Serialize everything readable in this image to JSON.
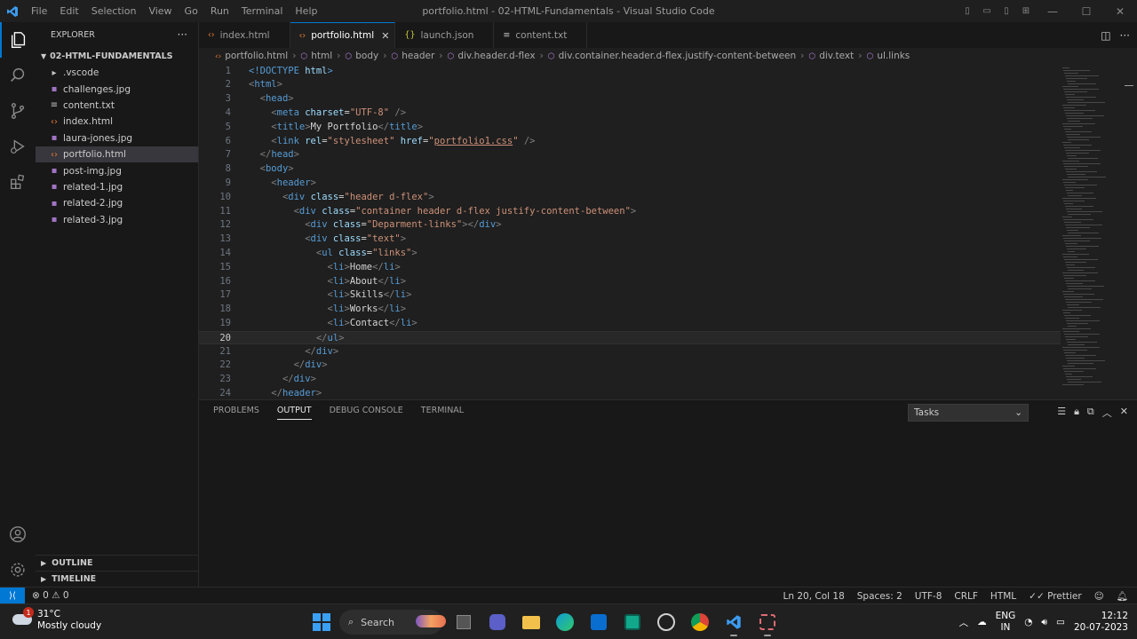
{
  "window": {
    "title": "portfolio.html - 02-HTML-Fundamentals - Visual Studio Code",
    "menu": [
      "File",
      "Edit",
      "Selection",
      "View",
      "Go",
      "Run",
      "Terminal",
      "Help"
    ]
  },
  "sidebar": {
    "header": "EXPLORER",
    "folder": "02-HTML-FUNDAMENTALS",
    "items": [
      {
        "label": ".vscode",
        "type": "folder"
      },
      {
        "label": "challenges.jpg",
        "type": "image"
      },
      {
        "label": "content.txt",
        "type": "text"
      },
      {
        "label": "index.html",
        "type": "html"
      },
      {
        "label": "laura-jones.jpg",
        "type": "image"
      },
      {
        "label": "portfolio.html",
        "type": "html",
        "selected": true
      },
      {
        "label": "post-img.jpg",
        "type": "image"
      },
      {
        "label": "related-1.jpg",
        "type": "image"
      },
      {
        "label": "related-2.jpg",
        "type": "image"
      },
      {
        "label": "related-3.jpg",
        "type": "image"
      }
    ],
    "outline": "OUTLINE",
    "timeline": "TIMELINE"
  },
  "tabs": [
    {
      "label": "index.html",
      "icon": "html-icon"
    },
    {
      "label": "portfolio.html",
      "icon": "html-icon",
      "active": true
    },
    {
      "label": "launch.json",
      "icon": "json-icon"
    },
    {
      "label": "content.txt",
      "icon": "text-file-icon"
    }
  ],
  "breadcrumbs": [
    "portfolio.html",
    "html",
    "body",
    "header",
    "div.header.d-flex",
    "div.container.header.d-flex.justify-content-between",
    "div.text",
    "ul.links"
  ],
  "editor": {
    "current_line": 20,
    "lines": [
      [
        [
          "t",
          "<!DOCTYPE "
        ],
        [
          "a",
          "html"
        ],
        [
          "t",
          ">"
        ]
      ],
      [
        [
          "p",
          "<"
        ],
        [
          "t",
          "html"
        ],
        [
          "p",
          ">"
        ]
      ],
      [
        [
          "x",
          "  "
        ],
        [
          "p",
          "<"
        ],
        [
          "t",
          "head"
        ],
        [
          "p",
          ">"
        ]
      ],
      [
        [
          "x",
          "    "
        ],
        [
          "p",
          "<"
        ],
        [
          "t",
          "meta "
        ],
        [
          "a",
          "charset"
        ],
        [
          "x",
          "="
        ],
        [
          "s",
          "\"UTF-8\""
        ],
        [
          "x",
          " "
        ],
        [
          "p",
          "/>"
        ]
      ],
      [
        [
          "x",
          "    "
        ],
        [
          "p",
          "<"
        ],
        [
          "t",
          "title"
        ],
        [
          "p",
          ">"
        ],
        [
          "x",
          "My Portfolio"
        ],
        [
          "p",
          "</"
        ],
        [
          "t",
          "title"
        ],
        [
          "p",
          ">"
        ]
      ],
      [
        [
          "x",
          "    "
        ],
        [
          "p",
          "<"
        ],
        [
          "t",
          "link "
        ],
        [
          "a",
          "rel"
        ],
        [
          "x",
          "="
        ],
        [
          "s",
          "\"stylesheet\""
        ],
        [
          "x",
          " "
        ],
        [
          "a",
          "href"
        ],
        [
          "x",
          "="
        ],
        [
          "s",
          "\""
        ],
        [
          "u",
          "portfolio1.css"
        ],
        [
          "s",
          "\""
        ],
        [
          "x",
          " "
        ],
        [
          "p",
          "/>"
        ]
      ],
      [
        [
          "x",
          "  "
        ],
        [
          "p",
          "</"
        ],
        [
          "t",
          "head"
        ],
        [
          "p",
          ">"
        ]
      ],
      [
        [
          "x",
          "  "
        ],
        [
          "p",
          "<"
        ],
        [
          "t",
          "body"
        ],
        [
          "p",
          ">"
        ]
      ],
      [
        [
          "x",
          "    "
        ],
        [
          "p",
          "<"
        ],
        [
          "t",
          "header"
        ],
        [
          "p",
          ">"
        ]
      ],
      [
        [
          "x",
          "      "
        ],
        [
          "p",
          "<"
        ],
        [
          "t",
          "div "
        ],
        [
          "a",
          "class"
        ],
        [
          "x",
          "="
        ],
        [
          "s",
          "\"header d-flex\""
        ],
        [
          "p",
          ">"
        ]
      ],
      [
        [
          "x",
          "        "
        ],
        [
          "p",
          "<"
        ],
        [
          "t",
          "div "
        ],
        [
          "a",
          "class"
        ],
        [
          "x",
          "="
        ],
        [
          "s",
          "\"container header d-flex justify-content-between\""
        ],
        [
          "p",
          ">"
        ]
      ],
      [
        [
          "x",
          "          "
        ],
        [
          "p",
          "<"
        ],
        [
          "t",
          "div "
        ],
        [
          "a",
          "class"
        ],
        [
          "x",
          "="
        ],
        [
          "s",
          "\"Deparment-links\""
        ],
        [
          "p",
          "></"
        ],
        [
          "t",
          "div"
        ],
        [
          "p",
          ">"
        ]
      ],
      [
        [
          "x",
          "          "
        ],
        [
          "p",
          "<"
        ],
        [
          "t",
          "div "
        ],
        [
          "a",
          "class"
        ],
        [
          "x",
          "="
        ],
        [
          "s",
          "\"text\""
        ],
        [
          "p",
          ">"
        ]
      ],
      [
        [
          "x",
          "            "
        ],
        [
          "p",
          "<"
        ],
        [
          "t",
          "ul "
        ],
        [
          "a",
          "class"
        ],
        [
          "x",
          "="
        ],
        [
          "s",
          "\"links\""
        ],
        [
          "p",
          ">"
        ]
      ],
      [
        [
          "x",
          "              "
        ],
        [
          "p",
          "<"
        ],
        [
          "t",
          "li"
        ],
        [
          "p",
          ">"
        ],
        [
          "x",
          "Home"
        ],
        [
          "p",
          "</"
        ],
        [
          "t",
          "li"
        ],
        [
          "p",
          ">"
        ]
      ],
      [
        [
          "x",
          "              "
        ],
        [
          "p",
          "<"
        ],
        [
          "t",
          "li"
        ],
        [
          "p",
          ">"
        ],
        [
          "x",
          "About"
        ],
        [
          "p",
          "</"
        ],
        [
          "t",
          "li"
        ],
        [
          "p",
          ">"
        ]
      ],
      [
        [
          "x",
          "              "
        ],
        [
          "p",
          "<"
        ],
        [
          "t",
          "li"
        ],
        [
          "p",
          ">"
        ],
        [
          "x",
          "Skills"
        ],
        [
          "p",
          "</"
        ],
        [
          "t",
          "li"
        ],
        [
          "p",
          ">"
        ]
      ],
      [
        [
          "x",
          "              "
        ],
        [
          "p",
          "<"
        ],
        [
          "t",
          "li"
        ],
        [
          "p",
          ">"
        ],
        [
          "x",
          "Works"
        ],
        [
          "p",
          "</"
        ],
        [
          "t",
          "li"
        ],
        [
          "p",
          ">"
        ]
      ],
      [
        [
          "x",
          "              "
        ],
        [
          "p",
          "<"
        ],
        [
          "t",
          "li"
        ],
        [
          "p",
          ">"
        ],
        [
          "x",
          "Contact"
        ],
        [
          "p",
          "</"
        ],
        [
          "t",
          "li"
        ],
        [
          "p",
          ">"
        ]
      ],
      [
        [
          "x",
          "            "
        ],
        [
          "p",
          "</"
        ],
        [
          "t",
          "ul"
        ],
        [
          "p",
          ">"
        ]
      ],
      [
        [
          "x",
          "          "
        ],
        [
          "p",
          "</"
        ],
        [
          "t",
          "div"
        ],
        [
          "p",
          ">"
        ]
      ],
      [
        [
          "x",
          "        "
        ],
        [
          "p",
          "</"
        ],
        [
          "t",
          "div"
        ],
        [
          "p",
          ">"
        ]
      ],
      [
        [
          "x",
          "      "
        ],
        [
          "p",
          "</"
        ],
        [
          "t",
          "div"
        ],
        [
          "p",
          ">"
        ]
      ],
      [
        [
          "x",
          "    "
        ],
        [
          "p",
          "</"
        ],
        [
          "t",
          "header"
        ],
        [
          "p",
          ">"
        ]
      ]
    ]
  },
  "panel": {
    "tabs": [
      "PROBLEMS",
      "OUTPUT",
      "DEBUG CONSOLE",
      "TERMINAL"
    ],
    "active_tab": "OUTPUT",
    "select": "Tasks"
  },
  "statusbar": {
    "problems": "⊗ 0 ⚠ 0",
    "position": "Ln 20, Col 18",
    "spaces": "Spaces: 2",
    "encoding": "UTF-8",
    "eol": "CRLF",
    "language": "HTML",
    "formatter": "Prettier"
  },
  "taskbar": {
    "weather_temp": "31°C",
    "weather_desc": "Mostly cloudy",
    "weather_badge": "1",
    "search": "Search",
    "lang_top": "ENG",
    "lang_bottom": "IN",
    "time": "12:12",
    "date": "20-07-2023"
  },
  "colors": {
    "accent": "#0078d4",
    "editor_bg": "#1f1f1f",
    "sidebar_bg": "#181818"
  }
}
